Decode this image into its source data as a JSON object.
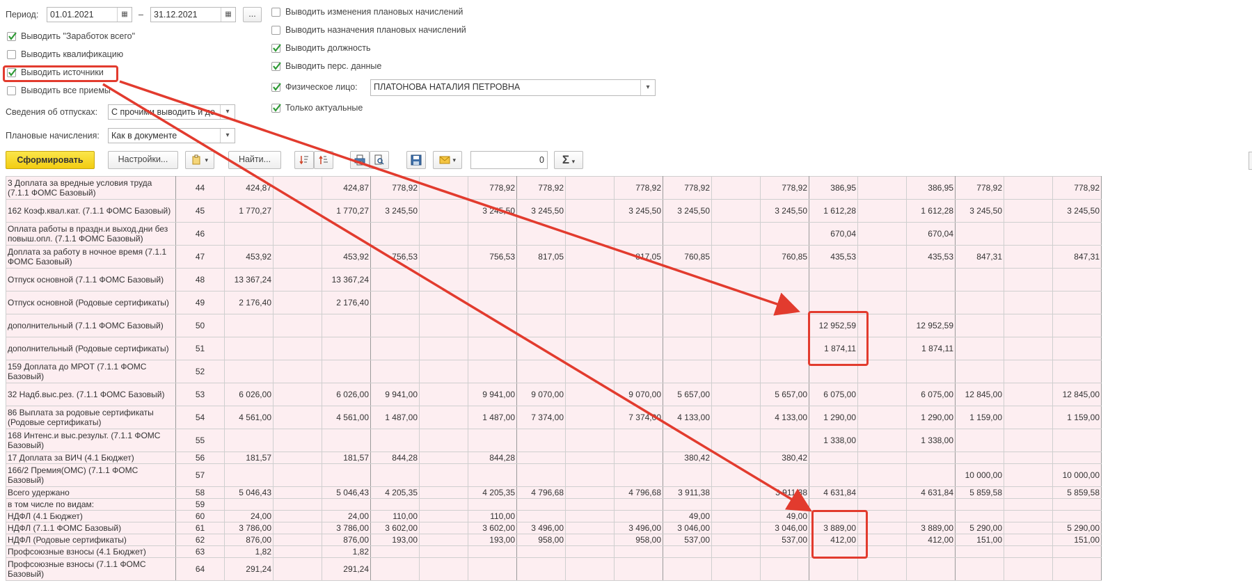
{
  "form": {
    "period_label": "Период:",
    "date_from": "01.01.2021",
    "date_dash": "–",
    "date_to": "31.12.2021",
    "more_label": "...",
    "checkboxes_left": [
      {
        "label": "Выводить \"Заработок всего\"",
        "checked": true
      },
      {
        "label": "Выводить квалификацию",
        "checked": false
      },
      {
        "label": "Выводить источники",
        "checked": true
      },
      {
        "label": "Выводить все приемы",
        "checked": false
      }
    ],
    "checkboxes_right": [
      {
        "label": "Выводить изменения плановых начислений",
        "checked": false
      },
      {
        "label": "Выводить назначения плановых начислений",
        "checked": false
      },
      {
        "label": "Выводить должность",
        "checked": true
      },
      {
        "label": "Выводить перс. данные",
        "checked": true
      },
      {
        "label": "Физическое лицо:",
        "checked": true
      },
      {
        "label": "Только актуальные",
        "checked": true
      }
    ],
    "person_value": "ПЛАТОНОВА НАТАЛИЯ ПЕТРОВНА",
    "vacation_label": "Сведения об отпусках:",
    "vacation_value": "С прочими выводить и до",
    "planned_label": "Плановые начисления:",
    "planned_value": "Как в документе"
  },
  "toolbar": {
    "generate_label": "Сформировать",
    "settings_label": "Настройки...",
    "find_label": "Найти...",
    "number_value": "0",
    "sum_symbol": "Σ"
  },
  "table": {
    "rows": [
      {
        "name": "3 Доплата за вредные условия труда (7.1.1 ФОМС Базовый)",
        "num": "44",
        "v": [
          "424,87",
          "",
          "424,87",
          "778,92",
          "",
          "778,92",
          "778,92",
          "",
          "778,92",
          "778,92",
          "",
          "778,92",
          "386,95",
          "",
          "386,95",
          "778,92",
          "",
          "778,92"
        ]
      },
      {
        "name": "162 Коэф.квал.кат. (7.1.1 ФОМС Базовый)",
        "num": "45",
        "v": [
          "1 770,27",
          "",
          "1 770,27",
          "3 245,50",
          "",
          "3 245,50",
          "3 245,50",
          "",
          "3 245,50",
          "3 245,50",
          "",
          "3 245,50",
          "1 612,28",
          "",
          "1 612,28",
          "3 245,50",
          "",
          "3 245,50"
        ]
      },
      {
        "name": "Оплата работы в праздн.и выход.дни без повыш.опл. (7.1.1 ФОМС Базовый)",
        "num": "46",
        "v": [
          "",
          "",
          "",
          "",
          "",
          "",
          "",
          "",
          "",
          "",
          "",
          "",
          "670,04",
          "",
          "670,04",
          "",
          "",
          ""
        ]
      },
      {
        "name": "Доплата за работу в ночное время (7.1.1 ФОМС Базовый)",
        "num": "47",
        "v": [
          "453,92",
          "",
          "453,92",
          "756,53",
          "",
          "756,53",
          "817,05",
          "",
          "817,05",
          "760,85",
          "",
          "760,85",
          "435,53",
          "",
          "435,53",
          "847,31",
          "",
          "847,31"
        ]
      },
      {
        "name": "Отпуск основной (7.1.1 ФОМС Базовый)",
        "num": "48",
        "v": [
          "13 367,24",
          "",
          "13 367,24",
          "",
          "",
          "",
          "",
          "",
          "",
          "",
          "",
          "",
          "",
          "",
          "",
          "",
          "",
          ""
        ]
      },
      {
        "name": "Отпуск основной (Родовые сертификаты)",
        "num": "49",
        "v": [
          "2 176,40",
          "",
          "2 176,40",
          "",
          "",
          "",
          "",
          "",
          "",
          "",
          "",
          "",
          "",
          "",
          "",
          "",
          "",
          ""
        ]
      },
      {
        "name": "дополнительный  (7.1.1 ФОМС Базовый)",
        "num": "50",
        "v": [
          "",
          "",
          "",
          "",
          "",
          "",
          "",
          "",
          "",
          "",
          "",
          "",
          "12 952,59",
          "",
          "12 952,59",
          "",
          "",
          ""
        ]
      },
      {
        "name": "дополнительный  (Родовые сертификаты)",
        "num": "51",
        "v": [
          "",
          "",
          "",
          "",
          "",
          "",
          "",
          "",
          "",
          "",
          "",
          "",
          "1 874,11",
          "",
          "1 874,11",
          "",
          "",
          ""
        ]
      },
      {
        "name": "159 Доплата до МРОТ  (7.1.1 ФОМС Базовый)",
        "num": "52",
        "v": [
          "",
          "",
          "",
          "",
          "",
          "",
          "",
          "",
          "",
          "",
          "",
          "",
          "",
          "",
          "",
          "",
          "",
          ""
        ]
      },
      {
        "name": "32 Надб.выс.рез. (7.1.1 ФОМС Базовый)",
        "num": "53",
        "v": [
          "6 026,00",
          "",
          "6 026,00",
          "9 941,00",
          "",
          "9 941,00",
          "9 070,00",
          "",
          "9 070,00",
          "5 657,00",
          "",
          "5 657,00",
          "6 075,00",
          "",
          "6 075,00",
          "12 845,00",
          "",
          "12 845,00"
        ]
      },
      {
        "name": "86 Выплата за родовые сертификаты (Родовые сертификаты)",
        "num": "54",
        "v": [
          "4 561,00",
          "",
          "4 561,00",
          "1 487,00",
          "",
          "1 487,00",
          "7 374,00",
          "",
          "7 374,00",
          "4 133,00",
          "",
          "4 133,00",
          "1 290,00",
          "",
          "1 290,00",
          "1 159,00",
          "",
          "1 159,00"
        ]
      },
      {
        "name": "168 Интенс.и выс.результ. (7.1.1 ФОМС Базовый)",
        "num": "55",
        "v": [
          "",
          "",
          "",
          "",
          "",
          "",
          "",
          "",
          "",
          "",
          "",
          "",
          "1 338,00",
          "",
          "1 338,00",
          "",
          "",
          ""
        ]
      },
      {
        "name": "17 Доплата за ВИЧ (4.1 Бюджет)",
        "num": "56",
        "v": [
          "181,57",
          "",
          "181,57",
          "844,28",
          "",
          "844,28",
          "",
          "",
          "",
          "380,42",
          "",
          "380,42",
          "",
          "",
          "",
          "",
          "",
          ""
        ]
      },
      {
        "name": "166/2 Премия(ОМС) (7.1.1 ФОМС Базовый)",
        "num": "57",
        "v": [
          "",
          "",
          "",
          "",
          "",
          "",
          "",
          "",
          "",
          "",
          "",
          "",
          "",
          "",
          "",
          "10 000,00",
          "",
          "10 000,00"
        ]
      },
      {
        "name": "Всего удержано",
        "num": "58",
        "v": [
          "5 046,43",
          "",
          "5 046,43",
          "4 205,35",
          "",
          "4 205,35",
          "4 796,68",
          "",
          "4 796,68",
          "3 911,38",
          "",
          "3 911,38",
          "4 631,84",
          "",
          "4 631,84",
          "5 859,58",
          "",
          "5 859,58"
        ]
      },
      {
        "name": "в том числе по видам:",
        "num": "59",
        "v": [
          "",
          "",
          "",
          "",
          "",
          "",
          "",
          "",
          "",
          "",
          "",
          "",
          "",
          "",
          "",
          "",
          "",
          ""
        ]
      },
      {
        "name": "НДФЛ (4.1 Бюджет)",
        "num": "60",
        "v": [
          "24,00",
          "",
          "24,00",
          "110,00",
          "",
          "110,00",
          "",
          "",
          "",
          "49,00",
          "",
          "49,00",
          "",
          "",
          "",
          "",
          "",
          ""
        ]
      },
      {
        "name": "НДФЛ (7.1.1 ФОМС Базовый)",
        "num": "61",
        "v": [
          "3 786,00",
          "",
          "3 786,00",
          "3 602,00",
          "",
          "3 602,00",
          "3 496,00",
          "",
          "3 496,00",
          "3 046,00",
          "",
          "3 046,00",
          "3 889,00",
          "",
          "3 889,00",
          "5 290,00",
          "",
          "5 290,00"
        ]
      },
      {
        "name": "НДФЛ (Родовые сертификаты)",
        "num": "62",
        "v": [
          "876,00",
          "",
          "876,00",
          "193,00",
          "",
          "193,00",
          "958,00",
          "",
          "958,00",
          "537,00",
          "",
          "537,00",
          "412,00",
          "",
          "412,00",
          "151,00",
          "",
          "151,00"
        ]
      },
      {
        "name": "Профсоюзные взносы (4.1 Бюджет)",
        "num": "63",
        "v": [
          "1,82",
          "",
          "1,82",
          "",
          "",
          "",
          "",
          "",
          "",
          "",
          "",
          "",
          "",
          "",
          "",
          "",
          "",
          ""
        ]
      },
      {
        "name": "Профсоюзные взносы (7.1.1 ФОМС Базовый)",
        "num": "64",
        "v": [
          "291,24",
          "",
          "291,24",
          "",
          "",
          "",
          "",
          "",
          "",
          "",
          "",
          "",
          "",
          "",
          "",
          "",
          "",
          ""
        ]
      }
    ]
  },
  "colors": {
    "highlight": "#e23b2e",
    "row_bg": "#fdeef1",
    "primary_button": "#f5d12a"
  }
}
